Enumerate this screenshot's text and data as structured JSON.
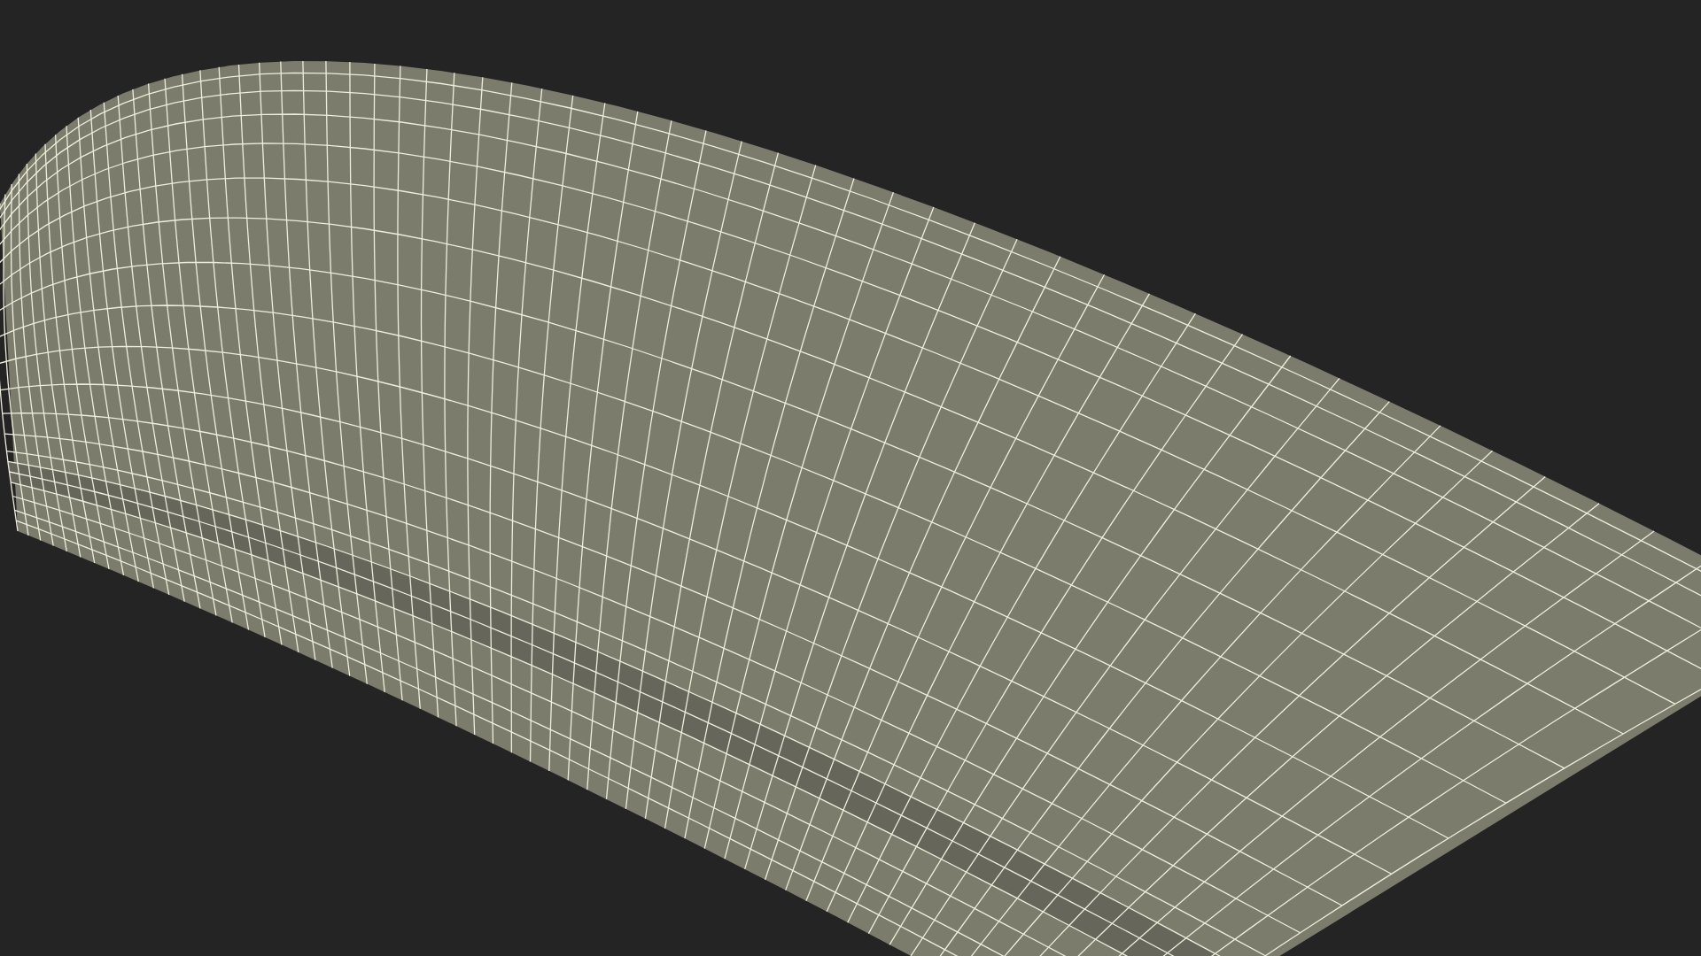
{
  "viewport": {
    "kind": "wireframe"
  }
}
